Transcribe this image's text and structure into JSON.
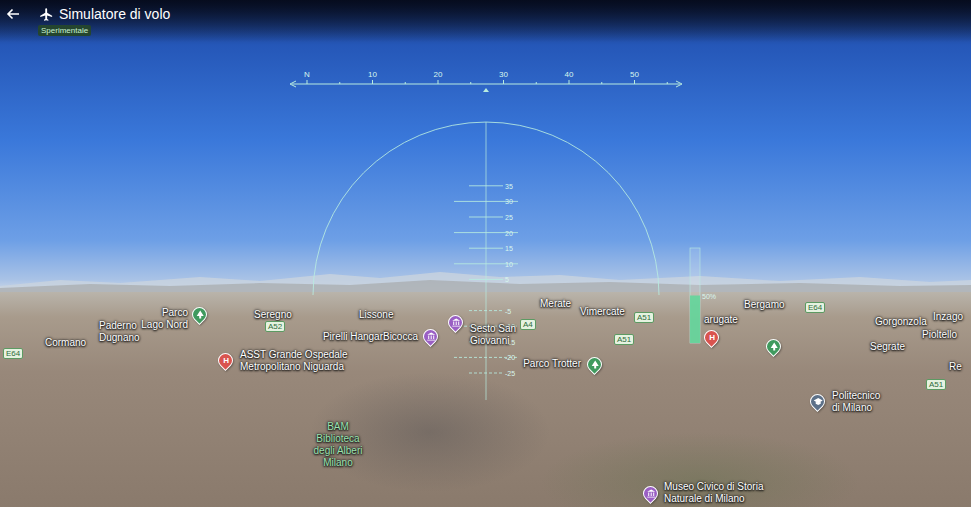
{
  "app": {
    "title": "Simulatore di volo",
    "badge": "Sperimentale"
  },
  "heading": {
    "ticks": [
      "N",
      "10",
      "20",
      "30",
      "40",
      "50"
    ]
  },
  "pitch_ladder": {
    "ticks": [
      "35",
      "30",
      "25",
      "20",
      "15",
      "10",
      "5",
      "-5",
      "-10",
      "-15",
      "-20",
      "-25"
    ]
  },
  "throttle": {
    "level": 0.5,
    "reading": "50%"
  },
  "map_labels": [
    {
      "lines": [
        "Parco",
        "Lago Nord"
      ],
      "kind": "park",
      "pin": true,
      "color": "#3f9a5e"
    },
    {
      "lines": [
        "Seregno"
      ],
      "kind": "place",
      "pin": false
    },
    {
      "lines": [
        "A52"
      ],
      "kind": "road",
      "pin": false
    },
    {
      "lines": [
        "Paderno",
        "Dugnano"
      ],
      "kind": "place",
      "pin": false
    },
    {
      "lines": [
        "Cormano"
      ],
      "kind": "place",
      "pin": false
    },
    {
      "lines": [
        "E64"
      ],
      "kind": "road",
      "pin": false
    },
    {
      "lines": [
        "ASST Grande Ospedale",
        "Metropolitano Niguarda"
      ],
      "kind": "hospital",
      "pin": true,
      "glyph": "H",
      "color": "#d9544f"
    },
    {
      "lines": [
        "Lissone"
      ],
      "kind": "place",
      "pin": false
    },
    {
      "lines": [
        "Pirelli HangarBicocca"
      ],
      "kind": "museum",
      "pin": true,
      "color": "#9a5fc4"
    },
    {
      "lines": [
        "Sesto San",
        "Giovanni"
      ],
      "kind": "museum",
      "pin": true,
      "color": "#9a5fc4"
    },
    {
      "lines": [
        "A4"
      ],
      "kind": "road",
      "pin": false
    },
    {
      "lines": [
        "Merate"
      ],
      "kind": "place",
      "pin": false
    },
    {
      "lines": [
        "Vimercate"
      ],
      "kind": "place",
      "pin": false
    },
    {
      "lines": [
        "A51"
      ],
      "kind": "road",
      "pin": false
    },
    {
      "lines": [
        "Parco Trotter"
      ],
      "kind": "park",
      "pin": true,
      "color": "#3f9a5e"
    },
    {
      "lines": [
        "A51"
      ],
      "kind": "road",
      "pin": false
    },
    {
      "lines": [
        "arugate"
      ],
      "kind": "place",
      "pin": false
    },
    {
      "lines": [],
      "kind": "hospital",
      "pin": true,
      "glyph": "H",
      "color": "#d9544f"
    },
    {
      "lines": [
        "Bergamo"
      ],
      "kind": "place",
      "pin": false
    },
    {
      "lines": [
        "E64"
      ],
      "kind": "road",
      "pin": false
    },
    {
      "lines": [],
      "kind": "park",
      "pin": true,
      "color": "#3f9a5e"
    },
    {
      "lines": [
        "Gorgonzola"
      ],
      "kind": "place",
      "pin": false
    },
    {
      "lines": [
        "Inzago"
      ],
      "kind": "place",
      "pin": false
    },
    {
      "lines": [
        "Pioltello"
      ],
      "kind": "place",
      "pin": false
    },
    {
      "lines": [
        "Segrate"
      ],
      "kind": "place",
      "pin": false
    },
    {
      "lines": [
        "Re"
      ],
      "kind": "place",
      "pin": false
    },
    {
      "lines": [
        "Politecnico",
        "di Milano"
      ],
      "kind": "landmark",
      "pin": true,
      "color": "#5d7189"
    },
    {
      "lines": [
        "A51"
      ],
      "kind": "road",
      "pin": false
    },
    {
      "lines": [
        "BAM",
        "Biblioteca",
        "degli Alberi",
        "Milano"
      ],
      "kind": "park",
      "pin": false,
      "color": "#9be3b0"
    },
    {
      "lines": [
        "Museo Civico di Storia",
        "Naturale di Milano"
      ],
      "kind": "museum",
      "pin": true,
      "color": "#9a5fc4"
    }
  ]
}
